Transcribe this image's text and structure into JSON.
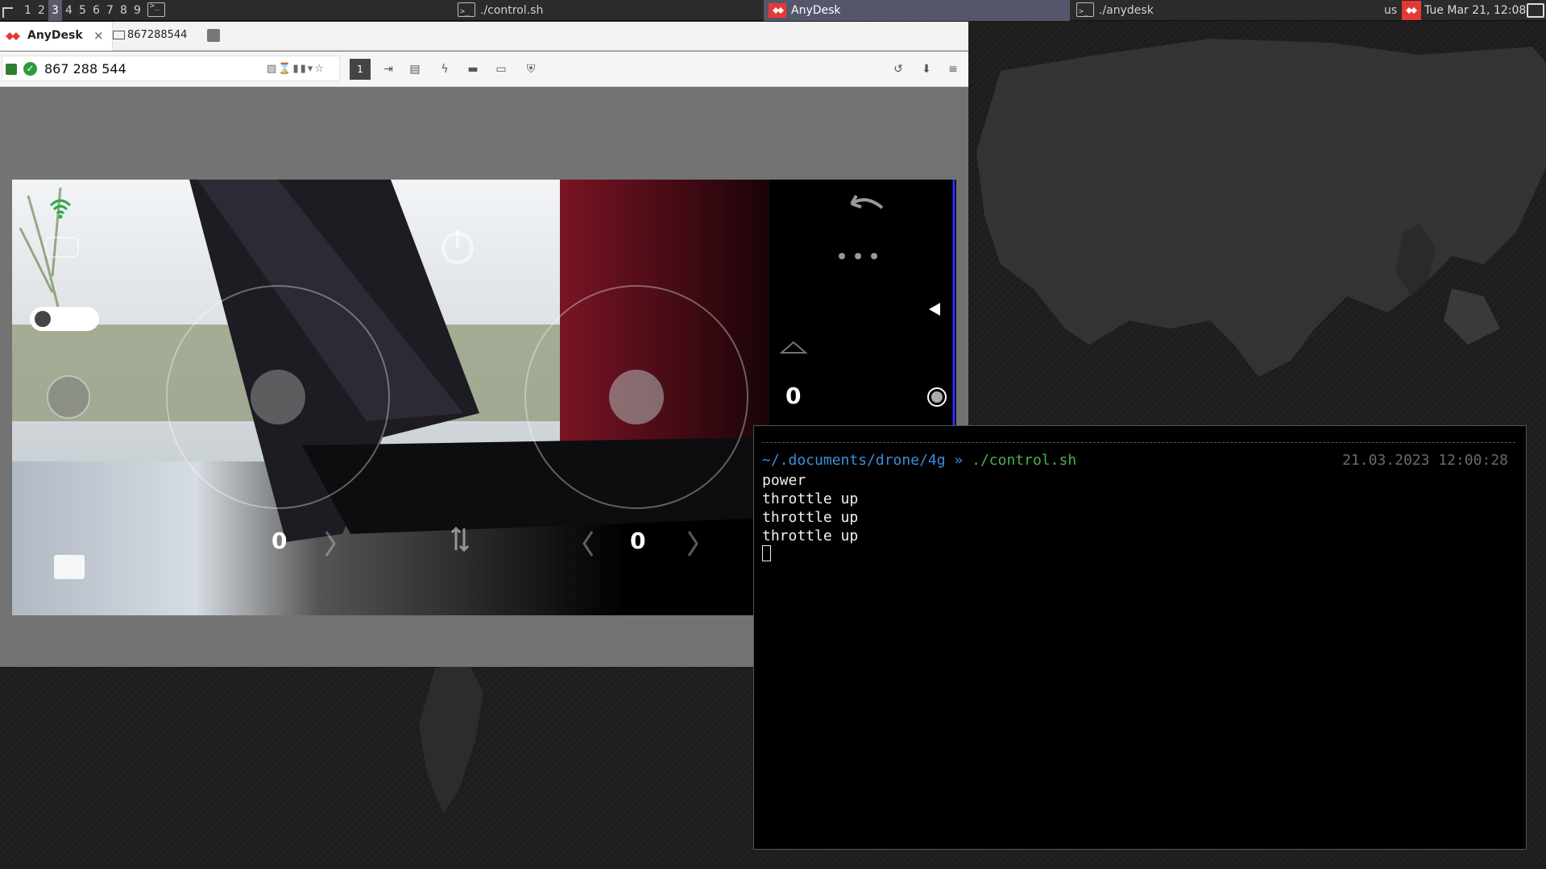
{
  "panel": {
    "workspaces": [
      "1",
      "2",
      "3",
      "4",
      "5",
      "6",
      "7",
      "8",
      "9"
    ],
    "active_workspace": "3",
    "tasks": [
      {
        "label": "./control.sh",
        "icon": "terminal-icon"
      },
      {
        "label": "AnyDesk",
        "icon": "anydesk-icon",
        "active": true
      },
      {
        "label": "./anydesk",
        "icon": "terminal-icon"
      }
    ],
    "keyboard_layout": "us",
    "clock": "Tue Mar 21, 12:08"
  },
  "anydesk": {
    "tab_home": "AnyDesk",
    "tab_close": "×",
    "tab_session": "867288544",
    "address": "867 288 544",
    "toolbar_display": "1",
    "colors": {
      "brand": "#e53935",
      "ok": "#2e9b3a"
    }
  },
  "remote_app": {
    "altitude_value": "0",
    "left_stick_value": "0",
    "right_stick_value": "0"
  },
  "terminal": {
    "prompt_path": "~/.documents/drone/4g",
    "prompt_arrow": "»",
    "prompt_cmd": "./control.sh",
    "timestamp": "21.03.2023 12:00:28",
    "output": [
      "power",
      "throttle up",
      "throttle up",
      "throttle up"
    ]
  }
}
